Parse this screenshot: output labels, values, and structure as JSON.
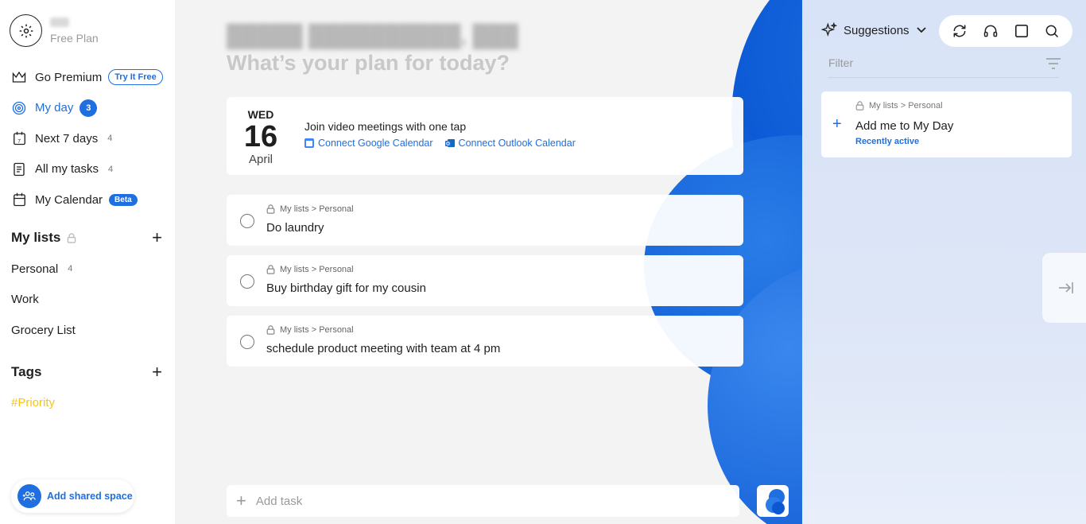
{
  "sidebar": {
    "plan": "Free Plan",
    "nav": {
      "premium": {
        "label": "Go Premium",
        "button": "Try It Free"
      },
      "my_day": {
        "label": "My day",
        "count": "3"
      },
      "next7": {
        "label": "Next 7 days",
        "count": "4"
      },
      "all_tasks": {
        "label": "All my tasks",
        "count": "4"
      },
      "calendar": {
        "label": "My Calendar",
        "badge": "Beta"
      }
    },
    "lists_title": "My lists",
    "lists": [
      {
        "label": "Personal",
        "count": "4"
      },
      {
        "label": "Work"
      },
      {
        "label": "Grocery List"
      }
    ],
    "tags_title": "Tags",
    "tags": [
      "#Priority"
    ],
    "shared_space": "Add shared space"
  },
  "main": {
    "subtitle": "What’s your plan for today?",
    "date": {
      "dow": "WED",
      "day": "16",
      "month": "April"
    },
    "calendar_prompt": "Join video meetings with one tap",
    "google_link": "Connect Google Calendar",
    "outlook_link": "Connect Outlook Calendar",
    "tasks": [
      {
        "path": "My lists > Personal",
        "title": "Do laundry"
      },
      {
        "path": "My lists > Personal",
        "title": "Buy birthday gift for my cousin"
      },
      {
        "path": "My lists > Personal",
        "title": "schedule product meeting with team at 4 pm"
      }
    ],
    "add_task_placeholder": "Add task"
  },
  "panel": {
    "title": "Suggestions",
    "filter_placeholder": "Filter",
    "card": {
      "path": "My lists > Personal",
      "title": "Add me to My Day",
      "meta": "Recently active"
    }
  },
  "colors": {
    "accent": "#1f6fe0",
    "tag": "#f5c518"
  }
}
